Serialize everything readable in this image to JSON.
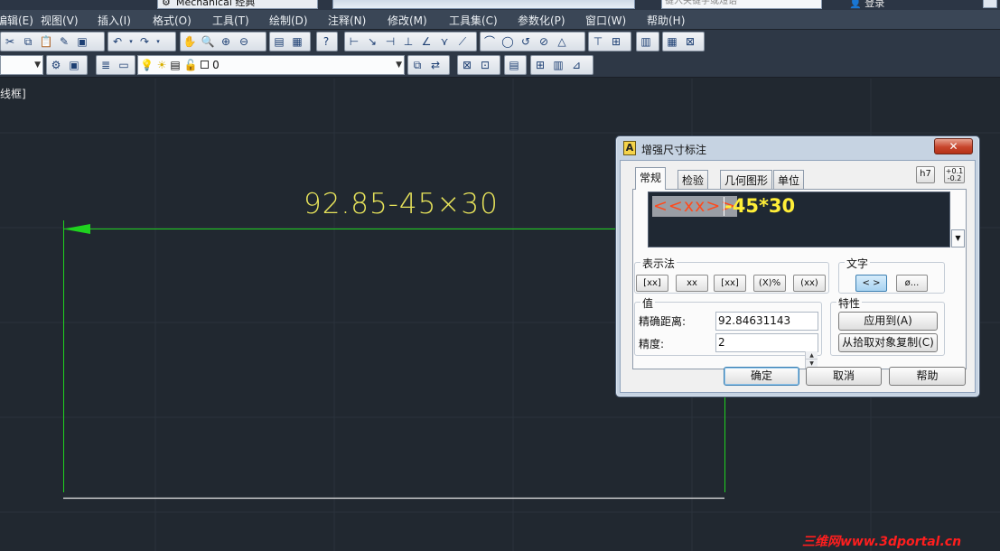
{
  "app": {
    "workspace": "Mechanical 经典",
    "search_placeholder": "键入关键字或短语",
    "login": "登录"
  },
  "menu": [
    "编辑(E)",
    "视图(V)",
    "插入(I)",
    "格式(O)",
    "工具(T)",
    "绘制(D)",
    "注释(N)",
    "修改(M)",
    "工具集(C)",
    "参数化(P)",
    "窗口(W)",
    "帮助(H)"
  ],
  "layer_toolbar": {
    "layer_name": "0"
  },
  "viewport": {
    "label": "线框]"
  },
  "drawing": {
    "dimension_text": "92.85-45×30",
    "line_color": "#1fd21f",
    "text_color": "#e6e25a",
    "bg_color": "#212830"
  },
  "watermark": "三维网www.3dportal.cn",
  "dialog": {
    "title": "增强尺寸标注",
    "tabs": [
      "常规",
      "检验",
      "几何图形",
      "单位"
    ],
    "active_tab": "常规",
    "tolerance_buttons": {
      "fit": "h7",
      "deviation_upper": "+0.1",
      "deviation_lower": "-0.2"
    },
    "editor": {
      "selected_text": "<<xx>>",
      "rest_text": "-45*30"
    },
    "representation": {
      "title": "表示法",
      "buttons": [
        "[xx]",
        "xx",
        "[xx]",
        "(X)%",
        "(xx)"
      ]
    },
    "text_group": {
      "title": "文字",
      "buttons": [
        "< >",
        "ø..."
      ]
    },
    "value_group": {
      "title": "值",
      "exact_distance_label": "精确距离:",
      "exact_distance_value": "92.84631143",
      "precision_label": "精度:",
      "precision_value": "2"
    },
    "properties_group": {
      "title": "特性",
      "apply_to": "应用到(A)",
      "copy_from": "从拾取对象复制(C)"
    },
    "buttons": {
      "ok": "确定",
      "cancel": "取消",
      "help": "帮助"
    }
  }
}
